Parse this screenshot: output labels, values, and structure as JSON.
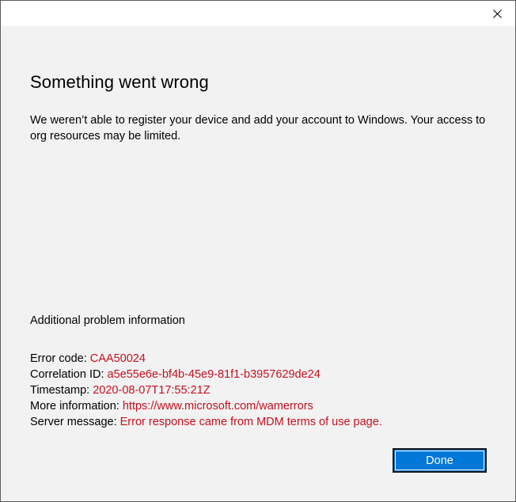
{
  "window": {
    "close_icon": "close-icon"
  },
  "dialog": {
    "heading": "Something went wrong",
    "message": "We weren’t able to register your device and add your account to Windows. Your access to org resources may be limited.",
    "info_heading": "Additional problem information",
    "details": [
      {
        "label": "Error code:",
        "value": "CAA50024"
      },
      {
        "label": "Correlation ID:",
        "value": "a5e55e6e-bf4b-45e9-81f1-b3957629de24"
      },
      {
        "label": "Timestamp:",
        "value": "2020-08-07T17:55:21Z"
      },
      {
        "label": "More information:",
        "value": "https://www.microsoft.com/wamerrors"
      },
      {
        "label": "Server message:",
        "value": "Error response came from MDM terms of use page."
      }
    ],
    "done_label": "Done"
  },
  "colors": {
    "error_value": "#c50f1f",
    "accent_button": "#0078d7",
    "background": "#f2f2f2"
  }
}
